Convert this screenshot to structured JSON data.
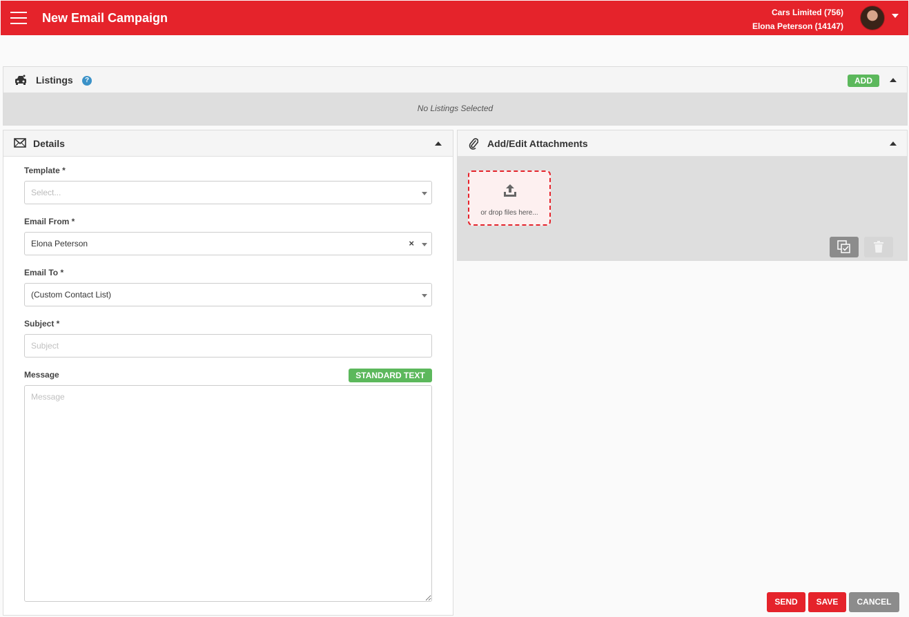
{
  "header": {
    "title": "New Email Campaign",
    "account_line1": "Cars Limited (756)",
    "account_line2": "Elona Peterson (14147)"
  },
  "listings": {
    "title": "Listings",
    "help_label": "?",
    "add_label": "ADD",
    "empty_text": "No Listings Selected"
  },
  "details": {
    "title": "Details",
    "template_label": "Template *",
    "template_placeholder": "Select...",
    "email_from_label": "Email From *",
    "email_from_value": "Elona Peterson",
    "email_to_label": "Email To *",
    "email_to_value": "(Custom Contact List)",
    "subject_label": "Subject *",
    "subject_placeholder": "Subject",
    "message_label": "Message",
    "standard_text_label": "STANDARD TEXT",
    "message_placeholder": "Message"
  },
  "attachments": {
    "title": "Add/Edit Attachments",
    "drop_text": "or drop files here..."
  },
  "actions": {
    "send": "SEND",
    "save": "SAVE",
    "cancel": "CANCEL"
  },
  "colors": {
    "brand_red": "#e5232b",
    "green": "#5cb85c",
    "grey_button": "#8c8c8c"
  }
}
